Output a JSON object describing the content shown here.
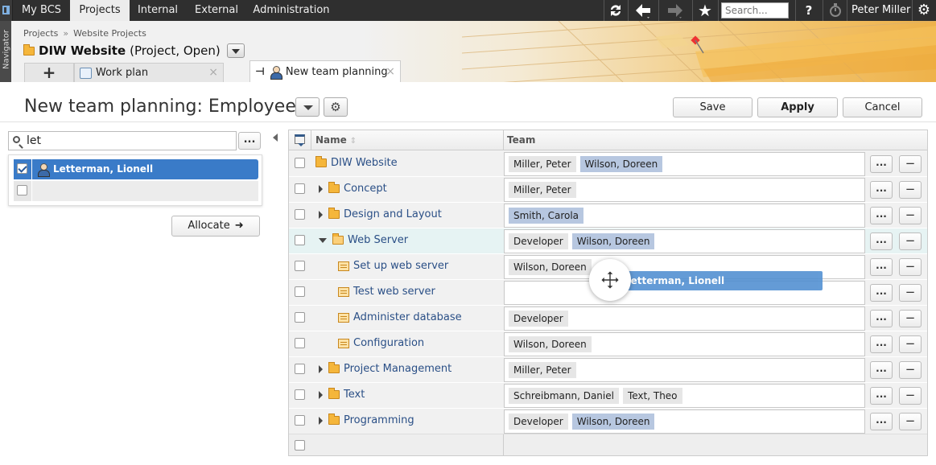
{
  "topnav": {
    "tabs": [
      {
        "label": "My BCS",
        "active": false
      },
      {
        "label": "Projects",
        "active": true
      },
      {
        "label": "Internal",
        "active": false
      },
      {
        "label": "External",
        "active": false
      },
      {
        "label": "Administration",
        "active": false
      }
    ],
    "icons": [
      "refresh-icon",
      "back-arrow-icon",
      "forward-arrow-icon",
      "star-icon"
    ],
    "search_placeholder": "Search...",
    "help_label": "?",
    "user_name": "Peter Miller"
  },
  "navigator_label": "Navigator",
  "header": {
    "breadcrumb": [
      "Projects",
      "Website Projects"
    ],
    "breadcrumb_sep": "»",
    "project_name": "DIW Website",
    "project_meta": "(Project, Open)",
    "tabs": [
      {
        "label": "Work plan",
        "active": false,
        "close": "×"
      },
      {
        "label": "New team planning",
        "active": true,
        "close": "×"
      }
    ],
    "add_tab_label": "+"
  },
  "page": {
    "title": "New team planning: Employee",
    "save_label": "Save",
    "apply_label": "Apply",
    "cancel_label": "Cancel"
  },
  "left_panel": {
    "search_value": "let",
    "more_label": "...",
    "results": [
      {
        "label": "Letterman, Lionell",
        "checked": true,
        "selected": true
      },
      {
        "label": "",
        "checked": false,
        "selected": false
      }
    ],
    "allocate_label": "Allocate"
  },
  "grid": {
    "columns": {
      "name": "Name",
      "team": "Team"
    },
    "rows": [
      {
        "name": "DIW Website",
        "level": 0,
        "expander": "none",
        "icon": "folder",
        "team": [
          {
            "label": "Miller, Peter",
            "kind": "role"
          },
          {
            "label": "Wilson, Doreen",
            "kind": "blue"
          }
        ]
      },
      {
        "name": "Concept",
        "level": 1,
        "expander": "closed",
        "icon": "folder",
        "team": [
          {
            "label": "Miller, Peter",
            "kind": "role"
          }
        ]
      },
      {
        "name": "Design and Layout",
        "level": 1,
        "expander": "closed",
        "icon": "folder",
        "team": [
          {
            "label": "Smith, Carola",
            "kind": "blue"
          }
        ]
      },
      {
        "name": "Web Server",
        "level": 1,
        "expander": "open",
        "icon": "folder",
        "highlight": true,
        "team": [
          {
            "label": "Developer",
            "kind": "role"
          },
          {
            "label": "Wilson, Doreen",
            "kind": "blue"
          }
        ]
      },
      {
        "name": "Set up web server",
        "level": 2,
        "expander": "none",
        "icon": "doc-folder",
        "team": [
          {
            "label": "Wilson, Doreen",
            "kind": "role"
          }
        ]
      },
      {
        "name": "Test web server",
        "level": 2,
        "expander": "none",
        "icon": "doc-folder",
        "team": []
      },
      {
        "name": "Administer database",
        "level": 2,
        "expander": "none",
        "icon": "doc-folder",
        "team": [
          {
            "label": "Developer",
            "kind": "role"
          }
        ]
      },
      {
        "name": "Configuration",
        "level": 2,
        "expander": "none",
        "icon": "doc-folder",
        "team": [
          {
            "label": "Wilson, Doreen",
            "kind": "role"
          }
        ]
      },
      {
        "name": "Project Management",
        "level": 1,
        "expander": "closed",
        "icon": "folder",
        "team": [
          {
            "label": "Miller, Peter",
            "kind": "role"
          }
        ]
      },
      {
        "name": "Text",
        "level": 1,
        "expander": "closed",
        "icon": "folder",
        "team": [
          {
            "label": "Schreibmann, Daniel",
            "kind": "role"
          },
          {
            "label": "Text, Theo",
            "kind": "role"
          }
        ]
      },
      {
        "name": "Programming",
        "level": 1,
        "expander": "closed",
        "icon": "folder",
        "team": [
          {
            "label": "Developer",
            "kind": "role"
          },
          {
            "label": "Wilson, Doreen",
            "kind": "blue"
          }
        ]
      }
    ],
    "row_more_label": "...",
    "row_remove_label": "−"
  },
  "drag": {
    "label": "Letterman, Lionell"
  }
}
